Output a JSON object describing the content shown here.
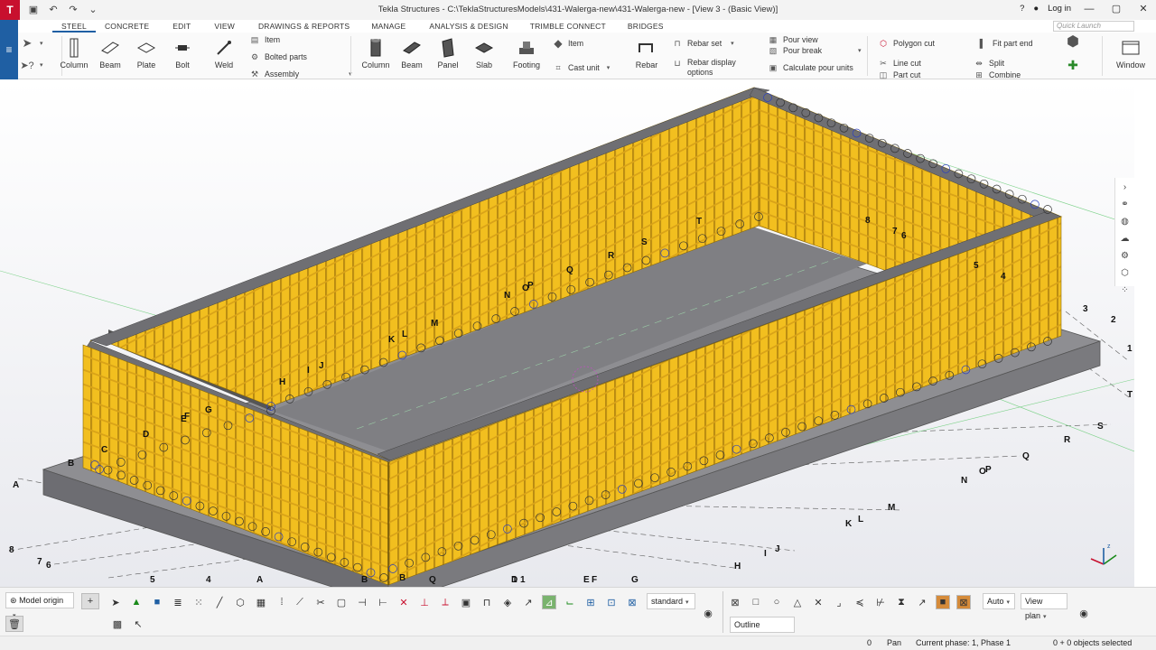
{
  "window": {
    "title": "Tekla Structures - C:\\TeklaStructuresModels\\431-Walerga-new\\431-Walerga-new - [View 3 - (Basic View)]",
    "login": "Log in"
  },
  "tabs": [
    "STEEL",
    "CONCRETE",
    "EDIT",
    "VIEW",
    "DRAWINGS & REPORTS",
    "MANAGE",
    "ANALYSIS & DESIGN",
    "TRIMBLE CONNECT",
    "BRIDGES"
  ],
  "active_tab": "STEEL",
  "quick_launch_placeholder": "Quick Launch",
  "ribbon": {
    "steel": {
      "column": "Column",
      "beam": "Beam",
      "plate": "Plate",
      "bolt": "Bolt",
      "weld": "Weld",
      "item": "Item",
      "bolted_parts": "Bolted parts",
      "assembly": "Assembly"
    },
    "concrete": {
      "column": "Column",
      "beam": "Beam",
      "panel": "Panel",
      "slab": "Slab",
      "footing": "Footing",
      "item": "Item",
      "cast_unit": "Cast unit",
      "rebar": "Rebar",
      "rebar_set": "Rebar set",
      "rebar_display_options_1": "Rebar display",
      "rebar_display_options_2": "options",
      "pour_view": "Pour view",
      "pour_break": "Pour break",
      "calculate_pour_units": "Calculate pour units"
    },
    "edit": {
      "polygon_cut": "Polygon cut",
      "line_cut": "Line cut",
      "part_cut": "Part cut",
      "fit_part_end": "Fit part end",
      "split": "Split",
      "combine": "Combine"
    },
    "window": "Window"
  },
  "grid_labels": {
    "letters_front": [
      "A",
      "B",
      "C",
      "D",
      "E",
      "F",
      "G",
      "H",
      "I",
      "J",
      "K",
      "L",
      "M",
      "N",
      "O",
      "P",
      "Q",
      "R",
      "S",
      "T"
    ],
    "numbers": [
      "1",
      "2",
      "3",
      "4",
      "5",
      "6",
      "7",
      "8"
    ]
  },
  "bottom": {
    "model_origin": "Model origin",
    "standard": "standard",
    "auto": "Auto",
    "view_plan": "View plan",
    "outline_planes": "Outline planes"
  },
  "status": {
    "zero": "0",
    "mode": "Pan",
    "phase": "Current phase: 1, Phase 1",
    "selection": "0 + 0 objects selected"
  },
  "colors": {
    "formwork": "#f2bf1f",
    "slab": "#8a8a8d",
    "accent": "#1f5fa3"
  }
}
